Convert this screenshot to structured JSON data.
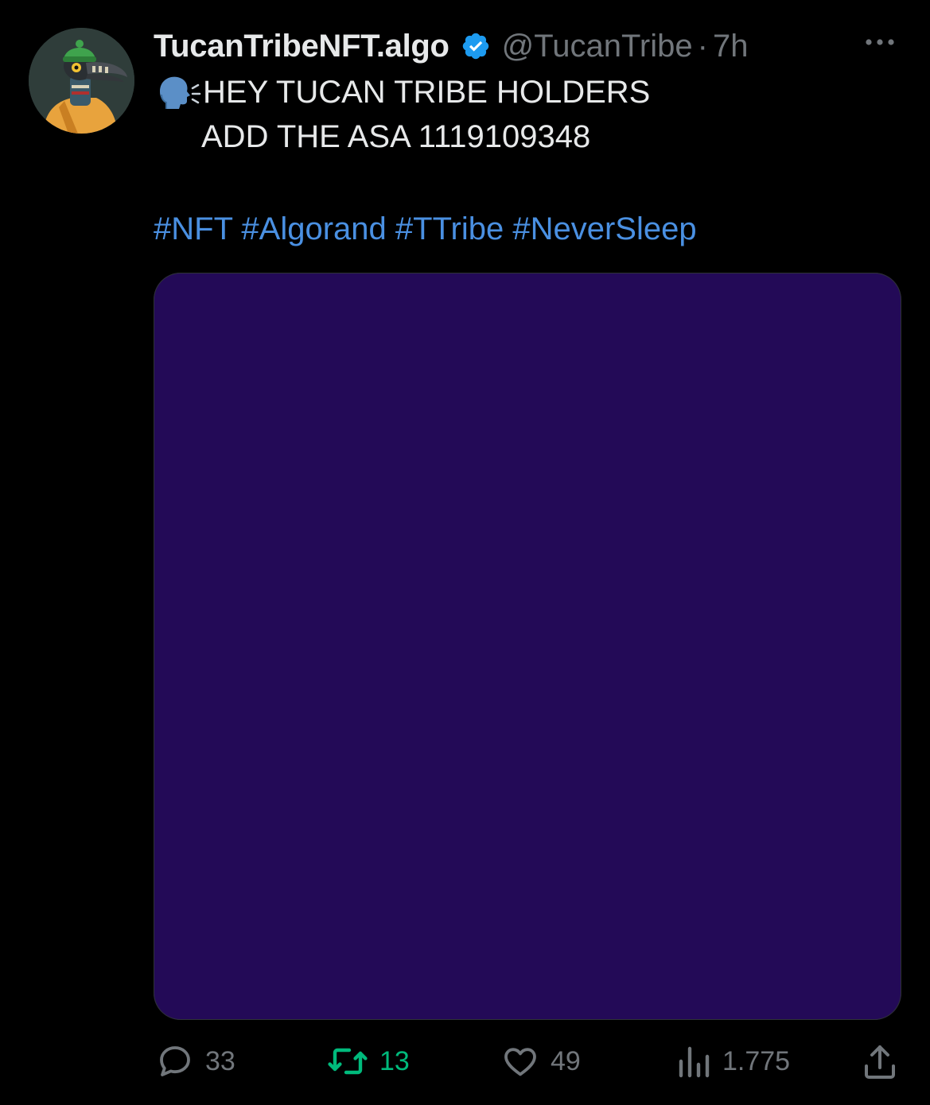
{
  "colors": {
    "background": "#000000",
    "text": "#e7e9ea",
    "muted": "#71767b",
    "link": "#4a90e2",
    "verified": "#1d9bf0",
    "retweet_active": "#00ba7c",
    "media_background": "#230a57"
  },
  "tweet": {
    "author": {
      "display_name": "TucanTribeNFT.algo",
      "handle": "@TucanTribe",
      "separator": "·",
      "time": "7h",
      "verified_icon": "verified-badge-icon",
      "avatar_icon": "toucan-avatar"
    },
    "more_icon": "more-horizontal-icon",
    "lead_emoji": "speaking-head-icon",
    "text_line1": "HEY TUCAN TRIBE HOLDERS",
    "text_line2": "ADD THE ASA 1119109348",
    "hashtags": [
      "#NFT",
      "#Algorand",
      "#TTribe",
      "#NeverSleep"
    ]
  },
  "actions": {
    "reply": {
      "icon": "reply-icon",
      "count": "33"
    },
    "retweet": {
      "icon": "retweet-icon",
      "count": "13"
    },
    "like": {
      "icon": "heart-icon",
      "count": "49"
    },
    "views": {
      "icon": "analytics-icon",
      "count": "1.775"
    },
    "share": {
      "icon": "share-icon"
    }
  }
}
